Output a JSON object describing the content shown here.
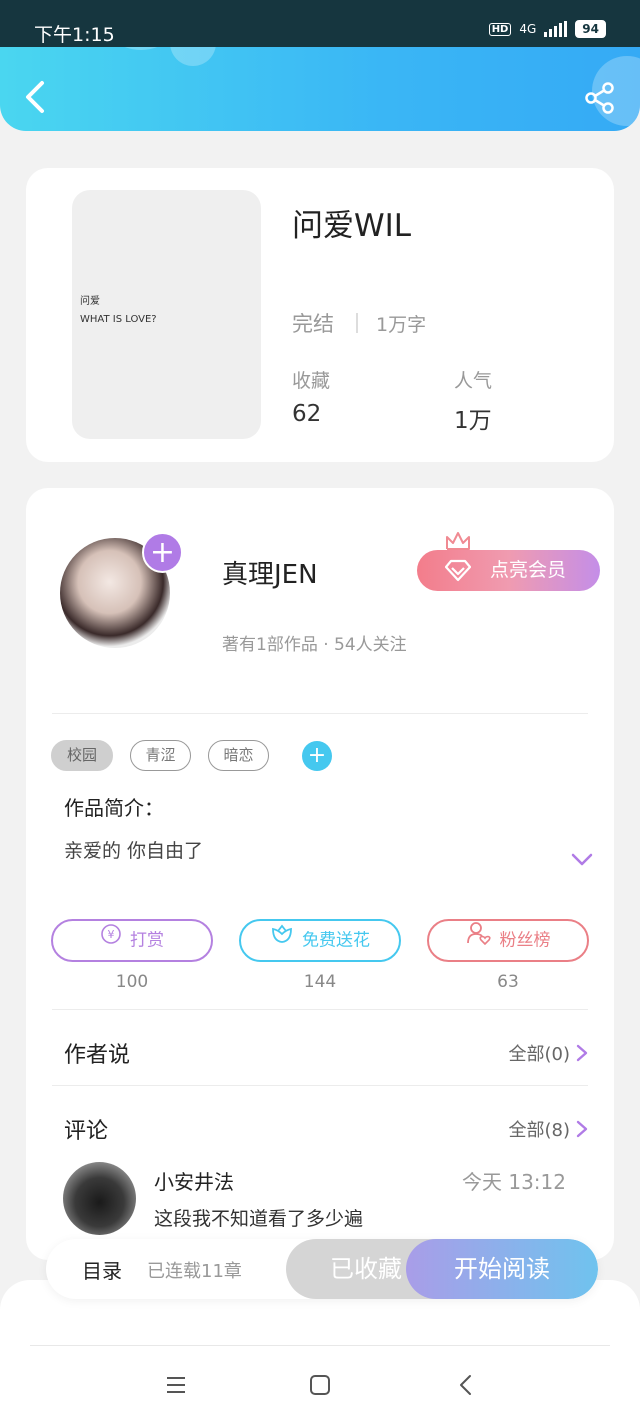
{
  "status_bar": {
    "time": "下午1:15",
    "hd": "HD",
    "network": "4G",
    "battery": "94"
  },
  "header": {
    "back_icon": "chevron-left-icon",
    "share_icon": "share-icon"
  },
  "book": {
    "cover_line1": "问爱",
    "cover_line2": "WHAT IS LOVE?",
    "title": "问爱WIL",
    "status": "完结",
    "word_count": "1万字",
    "favorites_label": "收藏",
    "favorites_value": "62",
    "popularity_label": "人气",
    "popularity_value": "1万"
  },
  "author": {
    "name": "真理JEN",
    "meta": "著有1部作品 · 54人关注",
    "vip_button": "点亮会员",
    "follow_plus": "+"
  },
  "tags": [
    "校园",
    "青涩",
    "暗恋"
  ],
  "intro": {
    "label": "作品简介：",
    "text": "亲爱的 你自由了"
  },
  "actions": [
    {
      "label": "打赏",
      "count": "100",
      "color": "#b481e0"
    },
    {
      "label": "免费送花",
      "count": "144",
      "color": "#45c8ef"
    },
    {
      "label": "粉丝榜",
      "count": "63",
      "color": "#ea7f86"
    }
  ],
  "author_says": {
    "title": "作者说",
    "more": "全部(0)"
  },
  "comments": {
    "title": "评论",
    "more": "全部(8)",
    "items": [
      {
        "user": "小安井法",
        "time": "今天 13:12",
        "text": "这段我不知道看了多少遍"
      }
    ]
  },
  "bottom_bar": {
    "catalog": "目录",
    "serial": "已连载11章",
    "collected": "已收藏",
    "read": "开始阅读"
  },
  "colors": {
    "accent_blue": "#3ab6f5",
    "accent_purple": "#b07be6",
    "accent_pink": "#ea7f86"
  }
}
